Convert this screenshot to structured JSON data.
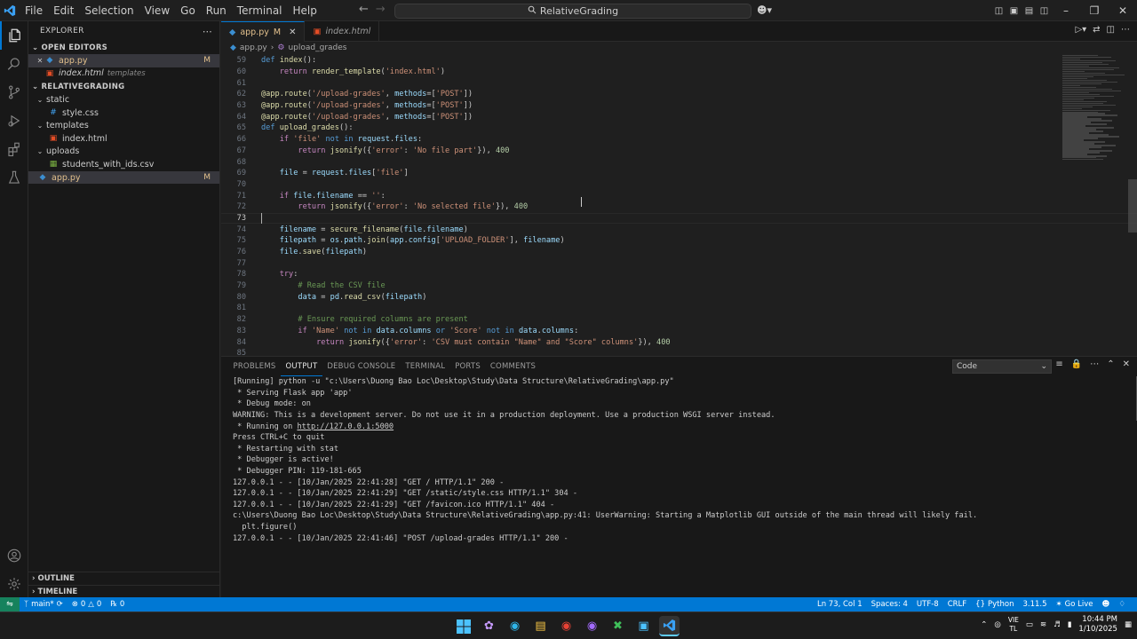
{
  "menu": [
    "File",
    "Edit",
    "Selection",
    "View",
    "Go",
    "Run",
    "Terminal",
    "Help"
  ],
  "search_title": "RelativeGrading",
  "explorer": {
    "title": "EXPLORER",
    "open_editors_label": "OPEN EDITORS",
    "open_editors": [
      {
        "name": "app.py",
        "badge": "M",
        "hint": ""
      },
      {
        "name": "index.html",
        "badge": "",
        "hint": "templates"
      }
    ],
    "project_label": "RELATIVEGRADING",
    "tree": [
      {
        "name": "static",
        "type": "folder",
        "depth": 1
      },
      {
        "name": "style.css",
        "type": "css",
        "depth": 2
      },
      {
        "name": "templates",
        "type": "folder",
        "depth": 1
      },
      {
        "name": "index.html",
        "type": "html",
        "depth": 2
      },
      {
        "name": "uploads",
        "type": "folder",
        "depth": 1
      },
      {
        "name": "students_with_ids.csv",
        "type": "csv",
        "depth": 2
      },
      {
        "name": "app.py",
        "type": "py",
        "depth": 1,
        "badge": "M"
      }
    ],
    "outline_label": "OUTLINE",
    "timeline_label": "TIMELINE"
  },
  "tabs": [
    {
      "name": "app.py",
      "modified": "M",
      "active": true
    },
    {
      "name": "index.html",
      "modified": "",
      "active": false
    }
  ],
  "breadcrumb": {
    "file": "app.py",
    "symbol": "upload_grades"
  },
  "code": {
    "current_line": 73,
    "lines": [
      {
        "n": 59,
        "t": "def index():"
      },
      {
        "n": 60,
        "t": "    return render_template('index.html')"
      },
      {
        "n": 61,
        "t": ""
      },
      {
        "n": 62,
        "t": "@app.route('/upload-grades', methods=['POST'])"
      },
      {
        "n": 63,
        "t": "@app.route('/upload-grades', methods=['POST'])"
      },
      {
        "n": 64,
        "t": "@app.route('/upload-grades', methods=['POST'])"
      },
      {
        "n": 65,
        "t": "def upload_grades():"
      },
      {
        "n": 66,
        "t": "    if 'file' not in request.files:"
      },
      {
        "n": 67,
        "t": "        return jsonify({'error': 'No file part'}), 400"
      },
      {
        "n": 68,
        "t": ""
      },
      {
        "n": 69,
        "t": "    file = request.files['file']"
      },
      {
        "n": 70,
        "t": ""
      },
      {
        "n": 71,
        "t": "    if file.filename == '':"
      },
      {
        "n": 72,
        "t": "        return jsonify({'error': 'No selected file'}), 400"
      },
      {
        "n": 73,
        "t": ""
      },
      {
        "n": 74,
        "t": "    filename = secure_filename(file.filename)"
      },
      {
        "n": 75,
        "t": "    filepath = os.path.join(app.config['UPLOAD_FOLDER'], filename)"
      },
      {
        "n": 76,
        "t": "    file.save(filepath)"
      },
      {
        "n": 77,
        "t": ""
      },
      {
        "n": 78,
        "t": "    try:"
      },
      {
        "n": 79,
        "t": "        # Read the CSV file"
      },
      {
        "n": 80,
        "t": "        data = pd.read_csv(filepath)"
      },
      {
        "n": 81,
        "t": ""
      },
      {
        "n": 82,
        "t": "        # Ensure required columns are present"
      },
      {
        "n": 83,
        "t": "        if 'Name' not in data.columns or 'Score' not in data.columns:"
      },
      {
        "n": 84,
        "t": "            return jsonify({'error': 'CSV must contain \"Name\" and \"Score\" columns'}), 400"
      },
      {
        "n": 85,
        "t": ""
      }
    ]
  },
  "panel": {
    "tabs": [
      "PROBLEMS",
      "OUTPUT",
      "DEBUG CONSOLE",
      "TERMINAL",
      "PORTS",
      "COMMENTS"
    ],
    "active_tab": "OUTPUT",
    "channel": "Code",
    "output": [
      "[Running] python -u \"c:\\Users\\Duong Bao Loc\\Desktop\\Study\\Data Structure\\RelativeGrading\\app.py\"",
      " * Serving Flask app 'app'",
      " * Debug mode: on",
      "WARNING: This is a development server. Do not use it in a production deployment. Use a production WSGI server instead.",
      " * Running on http://127.0.0.1:5000",
      "Press CTRL+C to quit",
      " * Restarting with stat",
      " * Debugger is active!",
      " * Debugger PIN: 119-181-665",
      "127.0.0.1 - - [10/Jan/2025 22:41:28] \"GET / HTTP/1.1\" 200 -",
      "127.0.0.1 - - [10/Jan/2025 22:41:29] \"GET /static/style.css HTTP/1.1\" 304 -",
      "127.0.0.1 - - [10/Jan/2025 22:41:29] \"GET /favicon.ico HTTP/1.1\" 404 -",
      "c:\\Users\\Duong Bao Loc\\Desktop\\Study\\Data Structure\\RelativeGrading\\app.py:41: UserWarning: Starting a Matplotlib GUI outside of the main thread will likely fail.",
      "  plt.figure()",
      "127.0.0.1 - - [10/Jan/2025 22:41:46] \"POST /upload-grades HTTP/1.1\" 200 -"
    ]
  },
  "status": {
    "branch": "main*",
    "errors": "0",
    "warnings": "0",
    "ports": "0",
    "position": "Ln 73, Col 1",
    "spaces": "Spaces: 4",
    "encoding": "UTF-8",
    "eol": "CRLF",
    "language": "Python",
    "version": "3.11.5",
    "golive": "Go Live"
  },
  "taskbar": {
    "lang_top": "VIE",
    "lang_bottom": "TL",
    "time": "10:44 PM",
    "date": "1/10/2025"
  },
  "colors": {
    "accent": "#0078d4",
    "statusbar": "#0078d4",
    "remote": "#16825d",
    "modified": "#e2c08d"
  }
}
